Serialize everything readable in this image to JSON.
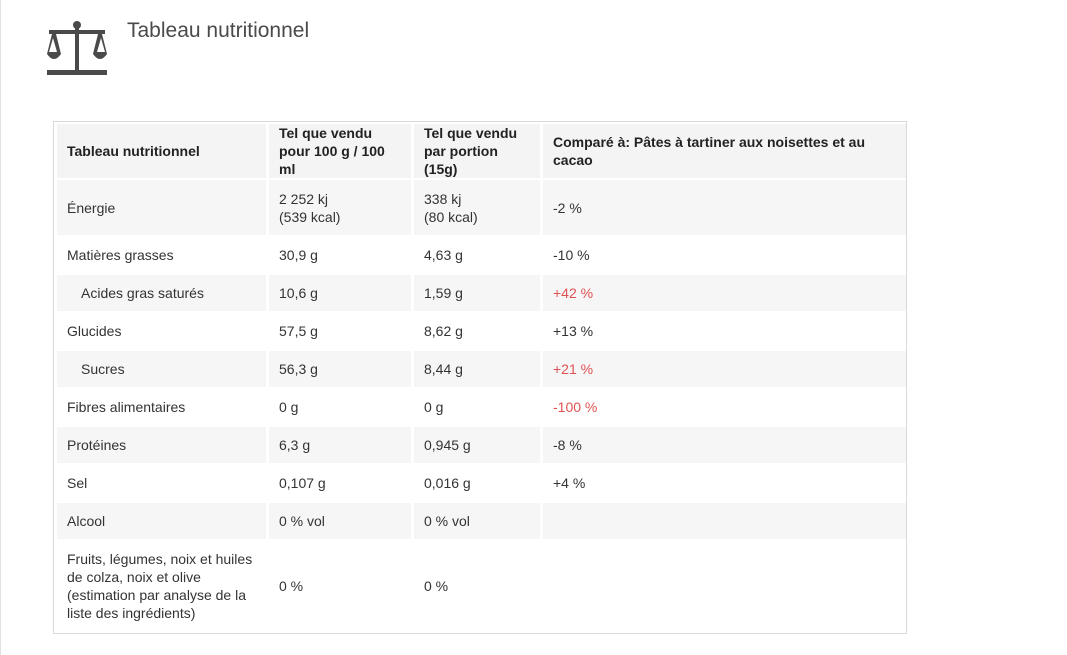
{
  "header": {
    "title": "Tableau nutritionnel",
    "icon": "scale-icon"
  },
  "colors": {
    "warning": "#e05252",
    "header_bg": "#f4f4f4",
    "row_alt_bg": "#f6f6f6",
    "icon": "#4a4a4a"
  },
  "table": {
    "columns": [
      "Tableau nutritionnel",
      "Tel que vendu\npour 100 g / 100 ml",
      "Tel que vendu\npar portion (15g)",
      "Comparé à: Pâtes à tartiner aux noisettes et au cacao"
    ],
    "rows": [
      {
        "name": "Énergie",
        "per100": "2 252 kj\n(539 kcal)",
        "portion": "338 kj\n(80 kcal)",
        "compare": "-2 %",
        "warn": false
      },
      {
        "name": "Matières grasses",
        "per100": "30,9 g",
        "portion": "4,63 g",
        "compare": "-10 %",
        "warn": false
      },
      {
        "name": "Acides gras saturés",
        "per100": "10,6 g",
        "portion": "1,59 g",
        "compare": "+42 %",
        "warn": true
      },
      {
        "name": "Glucides",
        "per100": "57,5 g",
        "portion": "8,62 g",
        "compare": "+13 %",
        "warn": false
      },
      {
        "name": "Sucres",
        "per100": "56,3 g",
        "portion": "8,44 g",
        "compare": "+21 %",
        "warn": true
      },
      {
        "name": "Fibres alimentaires",
        "per100": "0 g",
        "portion": "0 g",
        "compare": "-100 %",
        "warn": true
      },
      {
        "name": "Protéines",
        "per100": "6,3 g",
        "portion": "0,945 g",
        "compare": "-8 %",
        "warn": false
      },
      {
        "name": "Sel",
        "per100": "0,107 g",
        "portion": "0,016 g",
        "compare": "+4 %",
        "warn": false
      },
      {
        "name": "Alcool",
        "per100": "0 % vol",
        "portion": "0 % vol",
        "compare": "",
        "warn": false
      },
      {
        "name": "Fruits, légumes, noix et huiles de colza, noix et olive (estimation par analyse de la liste des ingrédients)",
        "per100": "0 %",
        "portion": "0 %",
        "compare": "",
        "warn": false
      }
    ]
  }
}
